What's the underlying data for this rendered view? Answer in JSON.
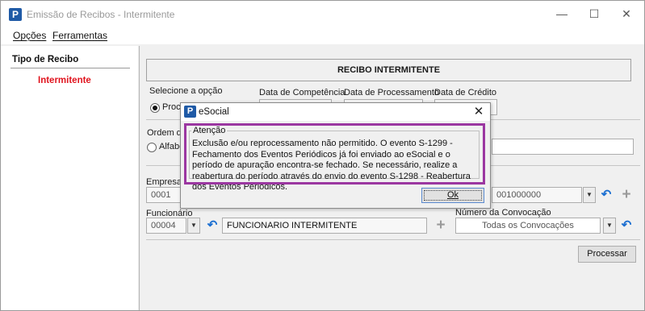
{
  "window": {
    "title": "Emissão de Recibos - Intermitente",
    "app_icon": "P",
    "controls": {
      "minimize": "—",
      "maximize": "☐",
      "close": "✕"
    }
  },
  "menu": {
    "items": [
      {
        "label": "Opções"
      },
      {
        "label": "Ferramentas"
      }
    ]
  },
  "sidebar": {
    "heading": "Tipo de Recibo",
    "items": [
      {
        "label": "Intermitente",
        "color": "#e0141e"
      }
    ]
  },
  "main": {
    "recibo_title": "RECIBO INTERMITENTE",
    "selecione_label": "Selecione a opção",
    "option_processamento": "Proce",
    "data_competencia_label": "Data de Competência",
    "data_processamento_label": "Data de Processamento",
    "data_credito_label": "Data de Crédito",
    "ordem_label": "Ordem de",
    "ordem_option": "Alfabé",
    "empresa_label": "Empresa",
    "empresa_value": "0001",
    "convocacao_code": "001000000",
    "funcionario_label": "Funcionário",
    "funcionario_code": "00004",
    "funcionario_name": "FUNCIONARIO INTERMITENTE",
    "numero_convocacao_label": "Número da Convocação",
    "numero_convocacao_value": "Todas os Convocações",
    "processar_button": "Processar"
  },
  "dialog": {
    "title": "eSocial",
    "icon": "P",
    "close": "✕",
    "group_title": "Atenção",
    "message": "Exclusão e/ou reprocessamento não permitido. O evento S-1299 - Fechamento dos Eventos Periódicos já foi enviado ao eSocial e o período de apuração encontra-se fechado. Se necessário, realize a reabertura do período através do envio do evento S-1298 - Reabertura dos Eventos Periódicos.",
    "ok_label": "Ok",
    "highlight_color": "#9b37a1"
  },
  "icons": {
    "dropdown": "▼",
    "undo": "↶",
    "add": "+"
  }
}
